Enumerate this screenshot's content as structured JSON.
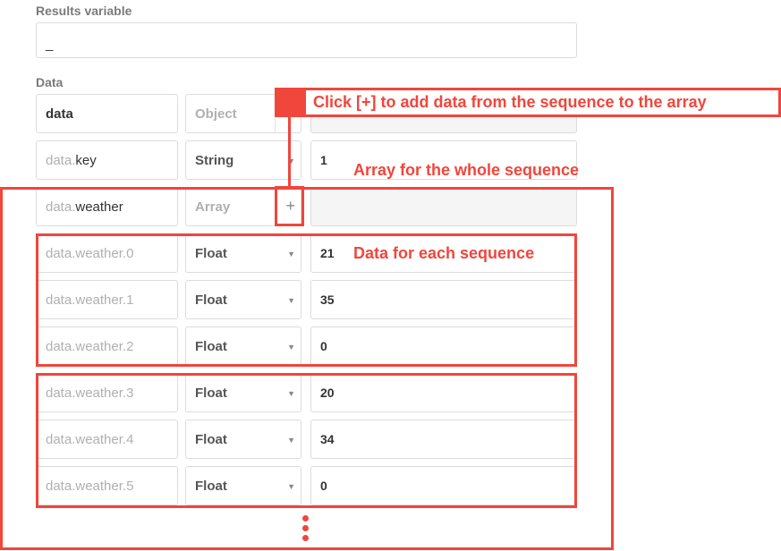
{
  "results_variable": {
    "label": "Results variable",
    "value": "_"
  },
  "data_section": {
    "label": "Data",
    "rows": [
      {
        "name_prefix": "",
        "name": "data",
        "style": "root",
        "type": "Object",
        "type_dim": true,
        "type_control": "none",
        "value": "",
        "value_disabled": true
      },
      {
        "name_prefix": "data.",
        "name": "key",
        "style": "child",
        "type": "String",
        "type_dim": false,
        "type_control": "dropdown",
        "value": "1",
        "value_disabled": false
      },
      {
        "name_prefix": "data.",
        "name": "weather",
        "style": "child",
        "type": "Array",
        "type_dim": true,
        "type_control": "add",
        "value": "",
        "value_disabled": true
      },
      {
        "name_prefix": "",
        "name": "data.weather.0",
        "style": "item",
        "type": "Float",
        "type_dim": false,
        "type_control": "dropdown",
        "value": "21",
        "value_disabled": false
      },
      {
        "name_prefix": "",
        "name": "data.weather.1",
        "style": "item",
        "type": "Float",
        "type_dim": false,
        "type_control": "dropdown",
        "value": "35",
        "value_disabled": false
      },
      {
        "name_prefix": "",
        "name": "data.weather.2",
        "style": "item",
        "type": "Float",
        "type_dim": false,
        "type_control": "dropdown",
        "value": "0",
        "value_disabled": false
      },
      {
        "name_prefix": "",
        "name": "data.weather.3",
        "style": "item",
        "type": "Float",
        "type_dim": false,
        "type_control": "dropdown",
        "value": "20",
        "value_disabled": false
      },
      {
        "name_prefix": "",
        "name": "data.weather.4",
        "style": "item",
        "type": "Float",
        "type_dim": false,
        "type_control": "dropdown",
        "value": "34",
        "value_disabled": false
      },
      {
        "name_prefix": "",
        "name": "data.weather.5",
        "style": "item",
        "type": "Float",
        "type_dim": false,
        "type_control": "dropdown",
        "value": "0",
        "value_disabled": false
      }
    ]
  },
  "icons": {
    "dropdown": "▼",
    "add": "+"
  },
  "annotations": {
    "callout": "Click [+] to add data from the sequence to the array",
    "array_label": "Array for the whole sequence",
    "each_label": "Data for each sequence",
    "color": "#f0463c"
  }
}
